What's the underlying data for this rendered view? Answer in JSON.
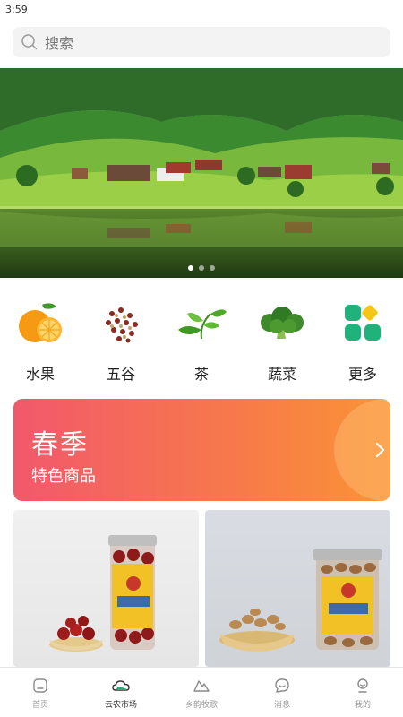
{
  "status": {
    "time": "3:59"
  },
  "search": {
    "placeholder": "搜索"
  },
  "banner": {
    "slides": 3,
    "active_index": 0
  },
  "categories": [
    {
      "label": "水果",
      "icon": "orange-icon"
    },
    {
      "label": "五谷",
      "icon": "grains-icon"
    },
    {
      "label": "茶",
      "icon": "tea-leaf-icon"
    },
    {
      "label": "蔬菜",
      "icon": "broccoli-icon"
    },
    {
      "label": "更多",
      "icon": "more-grid-icon"
    }
  ],
  "promo": {
    "title": "春季",
    "subtitle": "特色商品",
    "gradient_start": "#f2586c",
    "gradient_end": "#fa9436"
  },
  "products": [
    {
      "image": "dried-jujube-jar"
    },
    {
      "image": "cashew-jar"
    }
  ],
  "tabbar": {
    "items": [
      {
        "label": "首页",
        "icon": "home-icon"
      },
      {
        "label": "云农市场",
        "icon": "cloud-market-icon",
        "active": true
      },
      {
        "label": "乡韵牧歌",
        "icon": "mountain-icon"
      },
      {
        "label": "消息",
        "icon": "message-icon"
      },
      {
        "label": "我的",
        "icon": "profile-icon"
      }
    ],
    "active_color": "#2aa878"
  }
}
